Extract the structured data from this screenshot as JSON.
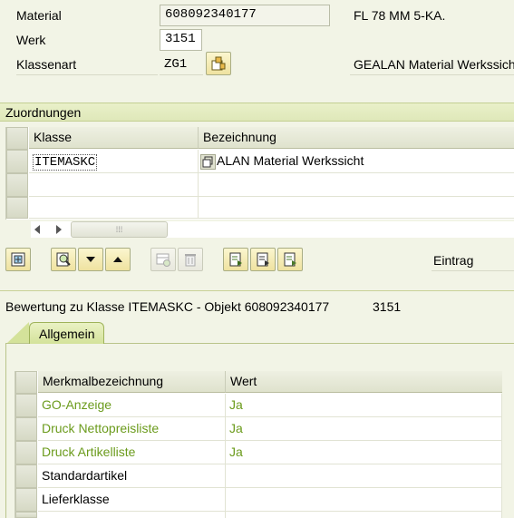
{
  "header": {
    "material_label": "Material",
    "material_value": "608092340177",
    "material_desc": "FL 78 MM 5-KA.",
    "werk_label": "Werk",
    "werk_value": "3151",
    "klassenart_label": "Klassenart",
    "klassenart_value": "ZG1",
    "klassenart_desc": "GEALAN Material Werkssicht"
  },
  "zuordnungen": {
    "title": "Zuordnungen",
    "columns": [
      "Klasse",
      "Bezeichnung"
    ],
    "rows": [
      {
        "klasse": "ITEMASKC",
        "bezeichnung": "ALAN Material Werkssicht"
      }
    ],
    "eintrag_label": "Eintrag"
  },
  "bewertung": {
    "title": "Bewertung zu Klasse ITEMASKC - Objekt 608092340177",
    "werk": "3151",
    "tab_label": "Allgemein",
    "columns": [
      "Merkmalbezeichnung",
      "Wert"
    ],
    "rows": [
      {
        "name": "GO-Anzeige",
        "wert": "Ja"
      },
      {
        "name": "Druck Nettopreisliste",
        "wert": "Ja"
      },
      {
        "name": "Druck Artikelliste",
        "wert": "Ja"
      },
      {
        "name": "Standardartikel",
        "wert": ""
      },
      {
        "name": "Lieferklasse",
        "wert": ""
      }
    ]
  },
  "colors": {
    "background": "#f2f4e6",
    "section_bar": "#e2eabd",
    "link_green": "#6b9b1c",
    "button_yellow": "#f4e9b2"
  }
}
